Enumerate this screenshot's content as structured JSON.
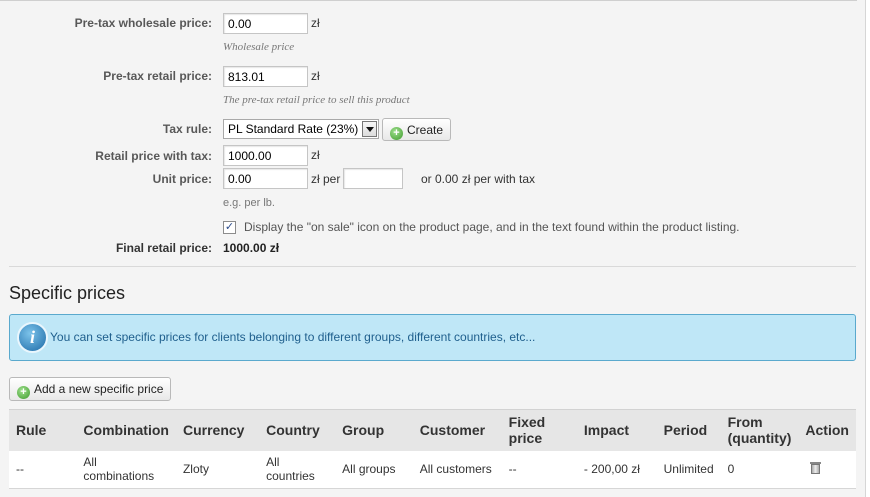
{
  "currency_symbol": "zł",
  "form": {
    "wholesale": {
      "label": "Pre-tax wholesale price:",
      "value": "0.00",
      "hint": "Wholesale price"
    },
    "retail": {
      "label": "Pre-tax retail price:",
      "value": "813.01",
      "hint": "The pre-tax retail price to sell this product"
    },
    "tax_rule": {
      "label": "Tax rule:",
      "selected": "PL Standard Rate (23%)",
      "create_label": "Create"
    },
    "retail_with_tax": {
      "label": "Retail price with tax:",
      "value": "1000.00"
    },
    "unit_price": {
      "label": "Unit price:",
      "value": "0.00",
      "per_label": "zł per",
      "per_value": "",
      "with_tax_text": "or 0.00 zł per with tax",
      "example": "e.g. per lb."
    },
    "on_sale": {
      "checked": true,
      "label": "Display the \"on sale\" icon on the product page, and in the text found within the product listing."
    },
    "final": {
      "label": "Final retail price:",
      "value": "1000.00 zł"
    }
  },
  "specific_prices": {
    "title": "Specific prices",
    "info": "You can set specific prices for clients belonging to different groups, different countries, etc...",
    "add_button": "Add a new specific price",
    "columns": [
      "Rule",
      "Combination",
      "Currency",
      "Country",
      "Group",
      "Customer",
      "Fixed price",
      "Impact",
      "Period",
      "From (quantity)",
      "Action"
    ],
    "rows": [
      {
        "rule": "--",
        "combination": "All combinations",
        "currency": "Zloty",
        "country": "All countries",
        "group": "All groups",
        "customer": "All customers",
        "fixed_price": "--",
        "impact": "- 200,00 zł",
        "period": "Unlimited",
        "from_qty": "0",
        "action_icon": "trash-icon"
      }
    ]
  },
  "colors": {
    "info_bg": "#bfe7f7",
    "info_border": "#5aa9cd",
    "info_text": "#1f5f8d",
    "panel_bg": "#f4f4f4"
  }
}
